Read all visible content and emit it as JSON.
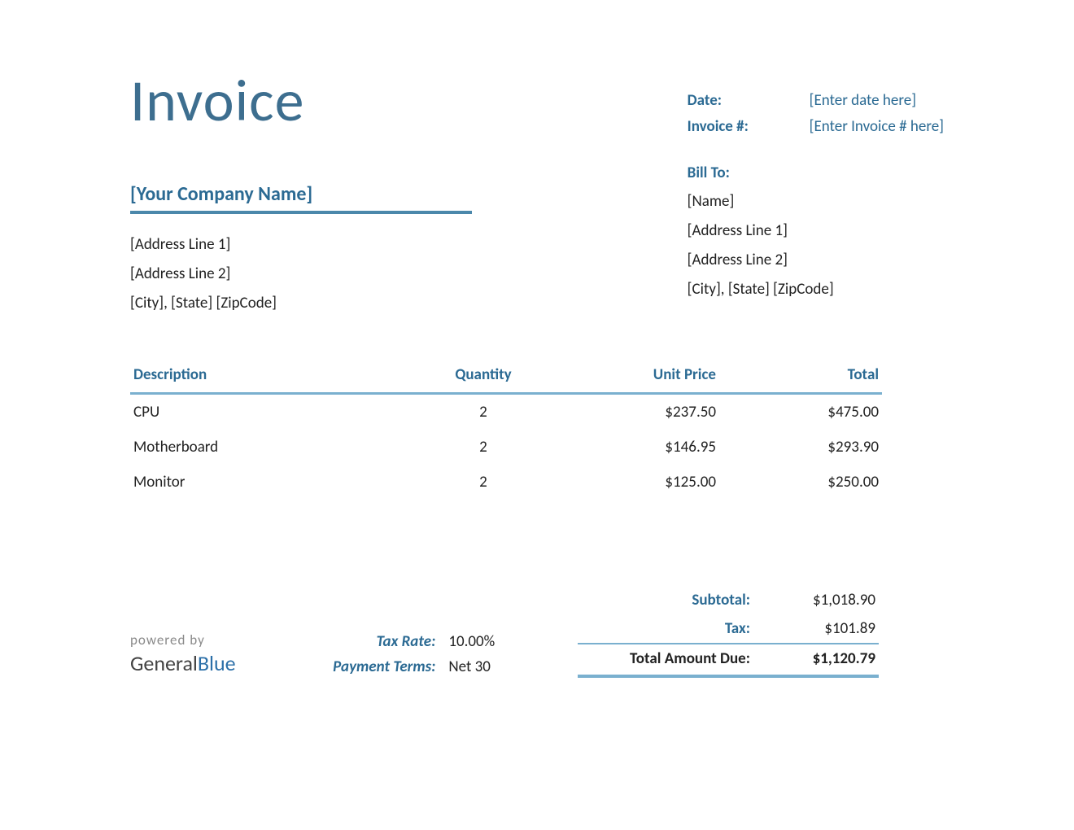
{
  "title": "Invoice",
  "meta": {
    "date_label": "Date:",
    "date_value": "[Enter date here]",
    "invoice_num_label": "Invoice #:",
    "invoice_num_value": "[Enter Invoice # here]"
  },
  "from": {
    "company": "[Your Company Name]",
    "address1": "[Address Line 1]",
    "address2": "[Address Line 2]",
    "city_state_zip": "[City], [State] [ZipCode]"
  },
  "billto": {
    "label": "Bill To:",
    "name": "[Name]",
    "address1": "[Address Line 1]",
    "address2": "[Address Line 2]",
    "city_state_zip": "[City], [State] [ZipCode]"
  },
  "columns": {
    "description": "Description",
    "quantity": "Quantity",
    "unit_price": "Unit Price",
    "total": "Total"
  },
  "items": [
    {
      "description": "CPU",
      "quantity": "2",
      "unit_price": "$237.50",
      "total": "$475.00"
    },
    {
      "description": "Motherboard",
      "quantity": "2",
      "unit_price": "$146.95",
      "total": "$293.90"
    },
    {
      "description": "Monitor",
      "quantity": "2",
      "unit_price": "$125.00",
      "total": "$250.00"
    }
  ],
  "terms": {
    "tax_rate_label": "Tax Rate:",
    "tax_rate_value": "10.00%",
    "payment_terms_label": "Payment Terms:",
    "payment_terms_value": "Net 30"
  },
  "totals": {
    "subtotal_label": "Subtotal:",
    "subtotal_value": "$1,018.90",
    "tax_label": "Tax:",
    "tax_value": "$101.89",
    "grand_label": "Total Amount Due:",
    "grand_value": "$1,120.79"
  },
  "branding": {
    "powered": "powered by",
    "name1": "General",
    "name2": "Blue"
  }
}
